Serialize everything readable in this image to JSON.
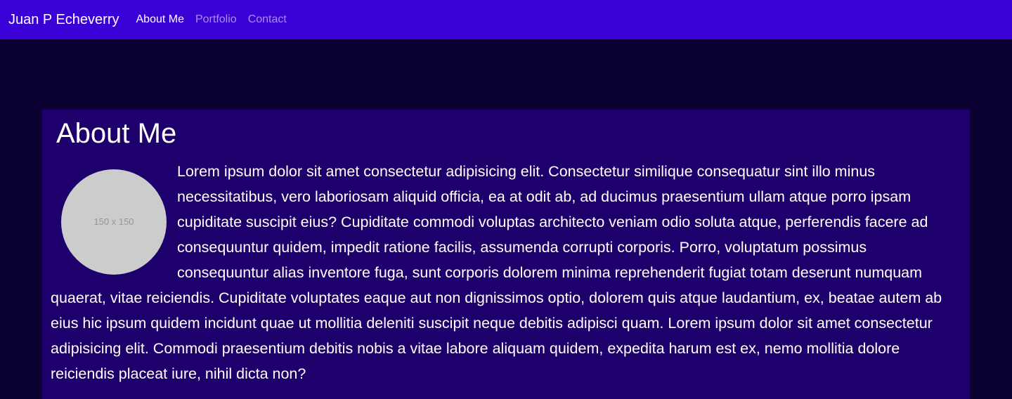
{
  "navbar": {
    "brand": "Juan P Echeverry",
    "links": [
      "About Me",
      "Portfolio",
      "Contact"
    ]
  },
  "about": {
    "title": "About Me",
    "avatar_placeholder": "150 x 150",
    "paragraph": "Lorem ipsum dolor sit amet consectetur adipisicing elit. Consectetur similique consequatur sint illo minus necessitatibus, vero laboriosam aliquid officia, ea at odit ab, ad ducimus praesentium ullam atque porro ipsam cupiditate suscipit eius? Cupiditate commodi voluptas architecto veniam odio soluta atque, perferendis facere ad consequuntur quidem, impedit ratione facilis, assumenda corrupti corporis. Porro, voluptatum possimus consequuntur alias inventore fuga, sunt corporis dolorem minima reprehenderit fugiat totam deserunt numquam quaerat, vitae reiciendis. Cupiditate voluptates eaque aut non dignissimos optio, dolorem quis atque laudantium, ex, beatae autem ab eius hic ipsum quidem incidunt quae ut mollitia deleniti suscipit neque debitis adipisci quam. Lorem ipsum dolor sit amet consectetur adipisicing elit. Commodi praesentium debitis nobis a vitae labore aliquam quidem, expedita harum est ex, nemo mollitia dolore reiciendis placeat iure, nihil dicta non?"
  },
  "colors": {
    "navbar_bg": "#3a00d6",
    "page_bg": "#0b0133",
    "card_bg": "#1d006b",
    "avatar_bg": "#cccccc"
  }
}
